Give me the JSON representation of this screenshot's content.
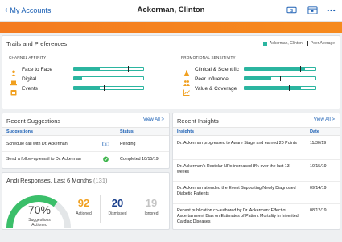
{
  "header": {
    "back_label": "My Accounts",
    "title": "Ackerman, Clinton",
    "icons": [
      "dollar-card-icon",
      "calendar-icon",
      "more-icon"
    ]
  },
  "trails": {
    "title": "Trails and Preferences",
    "legend_self": "Ackerman, Clinton",
    "legend_peer": "Peer Average",
    "channel_heading": "CHANNEL AFFINITY",
    "channel": [
      {
        "label": "Face to Face",
        "icon": "person-icon",
        "value": 0.37,
        "peer": 0.78
      },
      {
        "label": "Digital",
        "icon": "laptop-icon",
        "value": 0.12,
        "peer": 0.5
      },
      {
        "label": "Events",
        "icon": "event-icon",
        "value": 0.37,
        "peer": 0.43
      }
    ],
    "promo_heading": "PROMOTIONAL SENSITIVITY",
    "promo": [
      {
        "label": "Clinical & Scientific",
        "icon": "flask-icon",
        "value": 0.85,
        "peer": 0.78
      },
      {
        "label": "Peer Influence",
        "icon": "people-icon",
        "value": 0.38,
        "peer": 0.5
      },
      {
        "label": "Value & Coverage",
        "icon": "chart-icon",
        "value": 0.8,
        "peer": 0.62
      }
    ],
    "colors": {
      "accent": "#2bb5a0",
      "orange": "#f47b20",
      "link": "#1a5fb4"
    }
  },
  "suggestions": {
    "title": "Recent Suggestions",
    "view_all": "View All >",
    "col_suggestion": "Suggestions",
    "col_status": "Status",
    "rows": [
      {
        "text": "Schedule call with Dr. Ackerman",
        "icon": "dollar-card-icon",
        "status": "Pending"
      },
      {
        "text": "Send a follow-up email to Dr. Ackerman",
        "icon": "check-circle-icon",
        "status": "Completed 10/15/19"
      }
    ]
  },
  "andi": {
    "title": "Andi Responses, Last 6 Months",
    "count": "(131)",
    "percent": "70%",
    "percent_value": 0.7,
    "percent_label_1": "Suggestions",
    "percent_label_2": "Actioned",
    "actioned": "92",
    "actioned_label": "Actioned",
    "dismissed": "20",
    "dismissed_label": "Dismissed",
    "ignored": "19",
    "ignored_label": "Ignored"
  },
  "insights": {
    "title": "Recent Insights",
    "view_all": "View All >",
    "col_insight": "Insights",
    "col_date": "Date",
    "rows": [
      {
        "text": "Dr. Ackerman progressed to Aware Stage and earned 20 Points",
        "date": "11/30/19"
      },
      {
        "text": "Dr. Ackerman's Restolar NRx increased 8% over the last 13 weeks",
        "date": "10/15/19"
      },
      {
        "text": "Dr. Ackerman attended the Event Supporting Newly Diagnosed Diabetic Patients",
        "date": "09/14/19"
      },
      {
        "text": "Recent publication co-authored by Dr. Ackerman: Effect of Ascertainment Bias on Estimates of Patient Mortality in Inherited Cardiac Diseases",
        "date": "08/12/19"
      }
    ]
  }
}
